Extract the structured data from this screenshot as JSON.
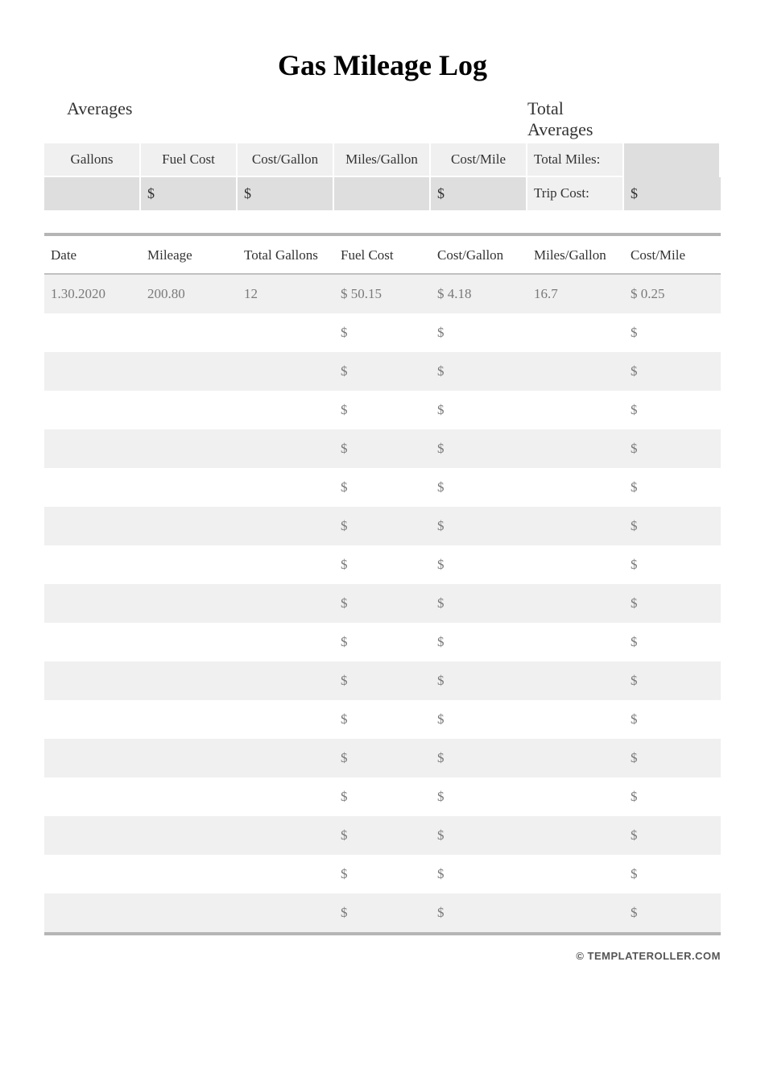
{
  "title": "Gas Mileage Log",
  "summary_section": {
    "averages_label": "Averages",
    "total_averages_label": "Total Averages",
    "headers": {
      "gallons": "Gallons",
      "fuel_cost": "Fuel Cost",
      "cost_per_gallon": "Cost/Gallon",
      "miles_per_gallon": "Miles/Gallon",
      "cost_per_mile": "Cost/Mile",
      "total_miles": "Total Miles:",
      "trip_cost": "Trip Cost:"
    },
    "values": {
      "gallons": "",
      "fuel_cost": "$",
      "cost_per_gallon": "$",
      "miles_per_gallon": "",
      "cost_per_mile": "$",
      "total_miles": "",
      "trip_cost": "$"
    }
  },
  "main_table": {
    "headers": {
      "date": "Date",
      "mileage": "Mileage",
      "total_gallons": "Total Gallons",
      "fuel_cost": "Fuel Cost",
      "cost_per_gallon": "Cost/Gallon",
      "miles_per_gallon": "Miles/Gallon",
      "cost_per_mile": "Cost/Mile"
    },
    "rows": [
      {
        "date": "1.30.2020",
        "mileage": "200.80",
        "total_gallons": "12",
        "fuel_cost": "$ 50.15",
        "cost_per_gallon": "$ 4.18",
        "miles_per_gallon": "16.7",
        "cost_per_mile": "$ 0.25"
      },
      {
        "date": "",
        "mileage": "",
        "total_gallons": "",
        "fuel_cost": "$",
        "cost_per_gallon": "$",
        "miles_per_gallon": "",
        "cost_per_mile": "$"
      },
      {
        "date": "",
        "mileage": "",
        "total_gallons": "",
        "fuel_cost": "$",
        "cost_per_gallon": "$",
        "miles_per_gallon": "",
        "cost_per_mile": "$"
      },
      {
        "date": "",
        "mileage": "",
        "total_gallons": "",
        "fuel_cost": "$",
        "cost_per_gallon": "$",
        "miles_per_gallon": "",
        "cost_per_mile": "$"
      },
      {
        "date": "",
        "mileage": "",
        "total_gallons": "",
        "fuel_cost": "$",
        "cost_per_gallon": "$",
        "miles_per_gallon": "",
        "cost_per_mile": "$"
      },
      {
        "date": "",
        "mileage": "",
        "total_gallons": "",
        "fuel_cost": "$",
        "cost_per_gallon": "$",
        "miles_per_gallon": "",
        "cost_per_mile": "$"
      },
      {
        "date": "",
        "mileage": "",
        "total_gallons": "",
        "fuel_cost": "$",
        "cost_per_gallon": "$",
        "miles_per_gallon": "",
        "cost_per_mile": "$"
      },
      {
        "date": "",
        "mileage": "",
        "total_gallons": "",
        "fuel_cost": "$",
        "cost_per_gallon": "$",
        "miles_per_gallon": "",
        "cost_per_mile": "$"
      },
      {
        "date": "",
        "mileage": "",
        "total_gallons": "",
        "fuel_cost": "$",
        "cost_per_gallon": "$",
        "miles_per_gallon": "",
        "cost_per_mile": "$"
      },
      {
        "date": "",
        "mileage": "",
        "total_gallons": "",
        "fuel_cost": "$",
        "cost_per_gallon": "$",
        "miles_per_gallon": "",
        "cost_per_mile": "$"
      },
      {
        "date": "",
        "mileage": "",
        "total_gallons": "",
        "fuel_cost": "$",
        "cost_per_gallon": "$",
        "miles_per_gallon": "",
        "cost_per_mile": "$"
      },
      {
        "date": "",
        "mileage": "",
        "total_gallons": "",
        "fuel_cost": "$",
        "cost_per_gallon": "$",
        "miles_per_gallon": "",
        "cost_per_mile": "$"
      },
      {
        "date": "",
        "mileage": "",
        "total_gallons": "",
        "fuel_cost": "$",
        "cost_per_gallon": "$",
        "miles_per_gallon": "",
        "cost_per_mile": "$"
      },
      {
        "date": "",
        "mileage": "",
        "total_gallons": "",
        "fuel_cost": "$",
        "cost_per_gallon": "$",
        "miles_per_gallon": "",
        "cost_per_mile": "$"
      },
      {
        "date": "",
        "mileage": "",
        "total_gallons": "",
        "fuel_cost": "$",
        "cost_per_gallon": "$",
        "miles_per_gallon": "",
        "cost_per_mile": "$"
      },
      {
        "date": "",
        "mileage": "",
        "total_gallons": "",
        "fuel_cost": "$",
        "cost_per_gallon": "$",
        "miles_per_gallon": "",
        "cost_per_mile": "$"
      },
      {
        "date": "",
        "mileage": "",
        "total_gallons": "",
        "fuel_cost": "$",
        "cost_per_gallon": "$",
        "miles_per_gallon": "",
        "cost_per_mile": "$"
      }
    ]
  },
  "footer": "© TEMPLATEROLLER.COM"
}
